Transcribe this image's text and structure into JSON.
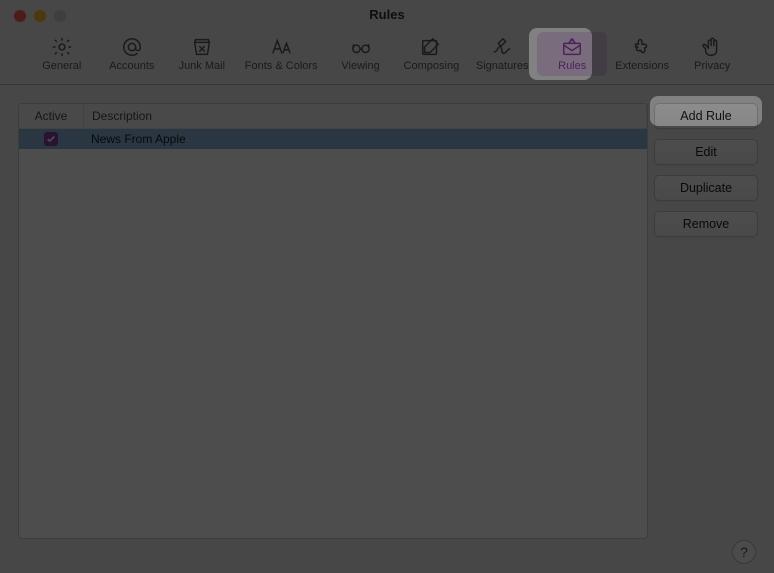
{
  "window": {
    "title": "Rules"
  },
  "toolbar": [
    {
      "name": "general",
      "label": "General"
    },
    {
      "name": "accounts",
      "label": "Accounts"
    },
    {
      "name": "junkmail",
      "label": "Junk Mail"
    },
    {
      "name": "fontscolors",
      "label": "Fonts & Colors"
    },
    {
      "name": "viewing",
      "label": "Viewing"
    },
    {
      "name": "composing",
      "label": "Composing"
    },
    {
      "name": "signatures",
      "label": "Signatures"
    },
    {
      "name": "rules",
      "label": "Rules",
      "selected": true
    },
    {
      "name": "extensions",
      "label": "Extensions"
    },
    {
      "name": "privacy",
      "label": "Privacy"
    }
  ],
  "table": {
    "headers": {
      "active": "Active",
      "description": "Description"
    },
    "rows": [
      {
        "active": true,
        "description": "News From Apple"
      }
    ]
  },
  "actions": {
    "add": "Add Rule",
    "edit": "Edit",
    "duplicate": "Duplicate",
    "remove": "Remove"
  },
  "help": "?",
  "colors": {
    "accent": "#8e3ea8",
    "selectionRow": "#8cb8e0"
  }
}
